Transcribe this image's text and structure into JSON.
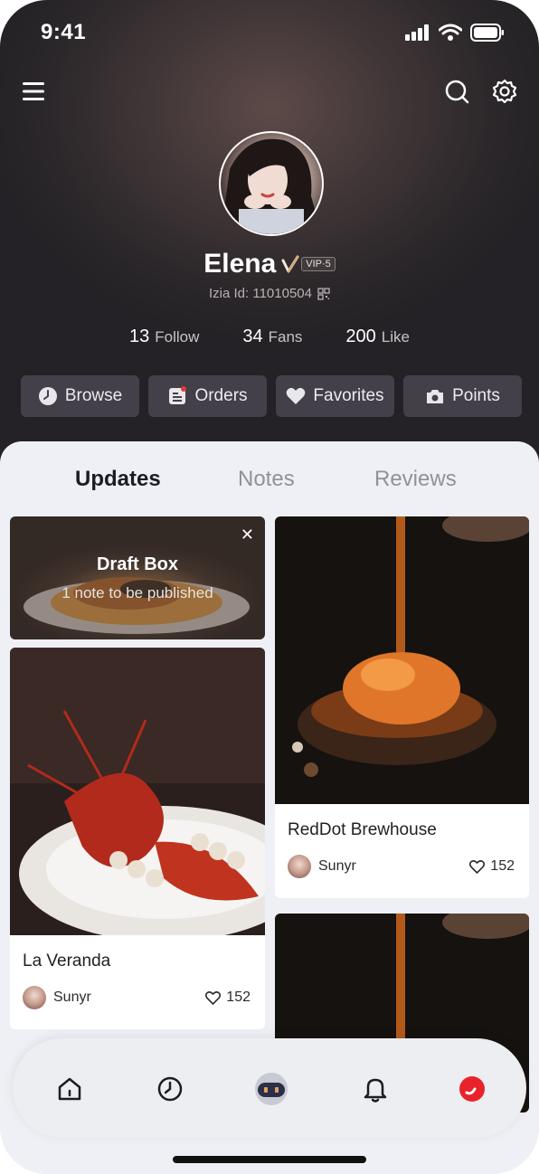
{
  "status_bar": {
    "time": "9:41"
  },
  "header": {
    "menu_icon": "hamburger-menu-icon",
    "search_icon": "search-icon",
    "settings_icon": "gear-icon"
  },
  "profile": {
    "name": "Elena",
    "vip_label": "VIP·5",
    "id_text": "Izia Id: 11010504",
    "stats": [
      {
        "value": "13",
        "label": "Follow"
      },
      {
        "value": "34",
        "label": "Fans"
      },
      {
        "value": "200",
        "label": "Like"
      }
    ]
  },
  "actions": [
    {
      "label": "Browse",
      "icon": "clock-icon"
    },
    {
      "label": "Orders",
      "icon": "orders-icon"
    },
    {
      "label": "Favorites",
      "icon": "heart-icon"
    },
    {
      "label": "Points",
      "icon": "camera-icon"
    }
  ],
  "tabs": [
    {
      "label": "Updates",
      "active": true
    },
    {
      "label": "Notes",
      "active": false
    },
    {
      "label": "Reviews",
      "active": false
    }
  ],
  "draft": {
    "title": "Draft Box",
    "subtitle": "1 note to be published"
  },
  "cards": [
    {
      "title": "La Veranda",
      "author": "Sunyr",
      "likes": "152"
    },
    {
      "title": "RedDot Brewhouse",
      "author": "Sunyr",
      "likes": "152"
    }
  ],
  "colors": {
    "accent": "#e53a3a",
    "header_bg": "#2a2629",
    "content_bg": "#eef0f5"
  },
  "bottom_nav": [
    "home-icon",
    "clock-icon",
    "robot-icon",
    "bell-icon",
    "brand-icon"
  ]
}
